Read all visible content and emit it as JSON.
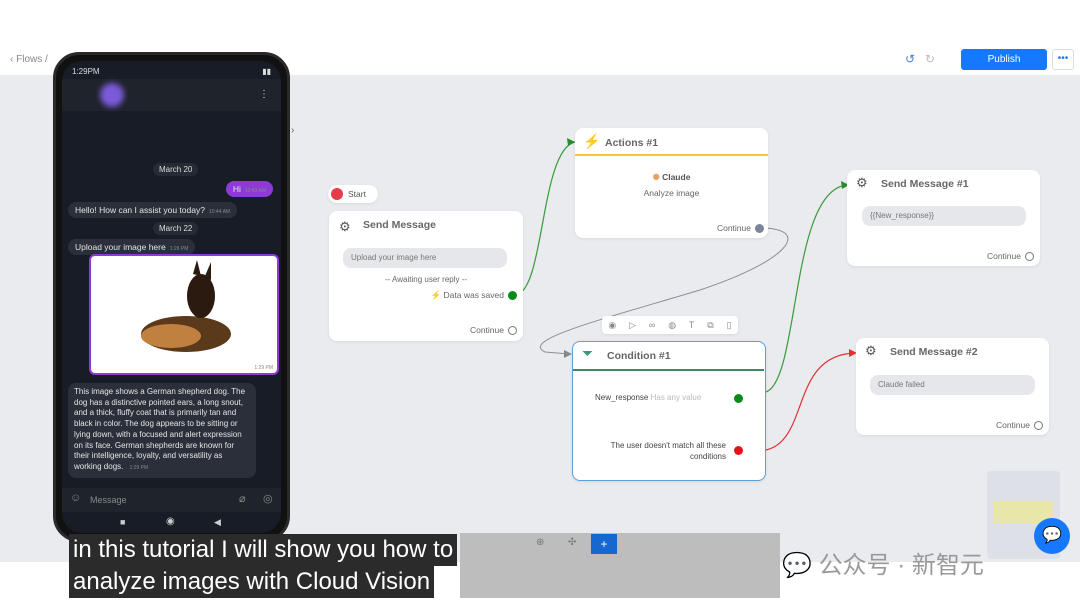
{
  "header": {
    "breadcrumb_back": "‹ Flows",
    "breadcrumb_sep": "/",
    "publish": "Publish",
    "more": "•••",
    "undo_icon": "undo-icon",
    "redo_icon": "redo-icon"
  },
  "phone": {
    "status_time": "1:29PM",
    "date1": "March 20",
    "msg_hi": "Hi",
    "msg_hi_time": "10:43 AM",
    "msg_hello": "Hello! How can I assist you today?",
    "msg_hello_time": "10:44 AM",
    "date2": "March 22",
    "msg_upload": "Upload your image here",
    "msg_upload_time": "1:28 PM",
    "img_time": "1:29 PM",
    "msg_desc": "This image shows a German shepherd dog. The dog has a distinctive pointed ears, a long snout, and a thick, fluffy coat that is primarily tan and black in color. The dog appears to be sitting or lying down, with a focused and alert expression on its face. German shepherds are known for their intelligence, loyalty, and versatility as working dogs.",
    "msg_desc_time": "1:29 PM",
    "input_placeholder": "Message"
  },
  "flow": {
    "start": "Start",
    "send_message": {
      "title": "Send Message",
      "text": "Upload your image here",
      "awaiting": "-- Awaiting user reply --",
      "saved": "Data was saved",
      "continue": "Continue"
    },
    "actions": {
      "title": "Actions #1",
      "provider": "Claude",
      "action": "Analyze image",
      "continue": "Continue"
    },
    "send1": {
      "title": "Send Message #1",
      "text": "{{New_response}}",
      "continue": "Continue"
    },
    "condition": {
      "title": "Condition #1",
      "var": "New_response",
      "op": "Has any value",
      "else": "The user doesn't match all these conditions"
    },
    "send2": {
      "title": "Send Message #2",
      "text": "Claude failed",
      "continue": "Continue"
    }
  },
  "colors": {
    "accent": "#1677ff",
    "success": "#0a8a1a",
    "error": "#e8101a",
    "actions": "#f3c640",
    "condition": "#5aa0e0"
  },
  "subtitle": {
    "line1": "in this tutorial I will show you how to",
    "line2": "analyze images with Cloud Vision"
  },
  "watermark": "公众号 · 新智元",
  "zoom_add": "+"
}
